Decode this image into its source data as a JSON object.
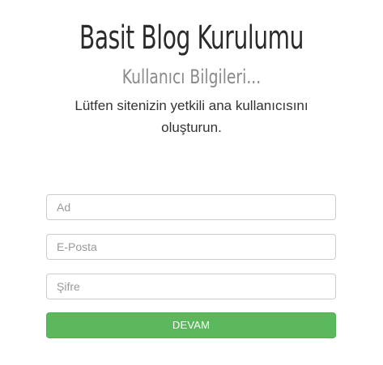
{
  "header": {
    "title": "Basit Blog Kurulumu",
    "subtitle": "Kullanıcı Bilgileri...",
    "description": "Lütfen sitenizin yetkili ana kullanıcısını oluşturun."
  },
  "form": {
    "name_placeholder": "Ad",
    "name_value": "",
    "email_placeholder": "E-Posta",
    "email_value": "",
    "password_placeholder": "Şifre",
    "password_value": "",
    "submit_label": "DEVAM"
  },
  "colors": {
    "title": "#2b2b2b",
    "subtitle": "#8a8a8a",
    "submit_background": "#5cb85c",
    "submit_text": "#ffffff",
    "field_border": "#cccccc"
  }
}
